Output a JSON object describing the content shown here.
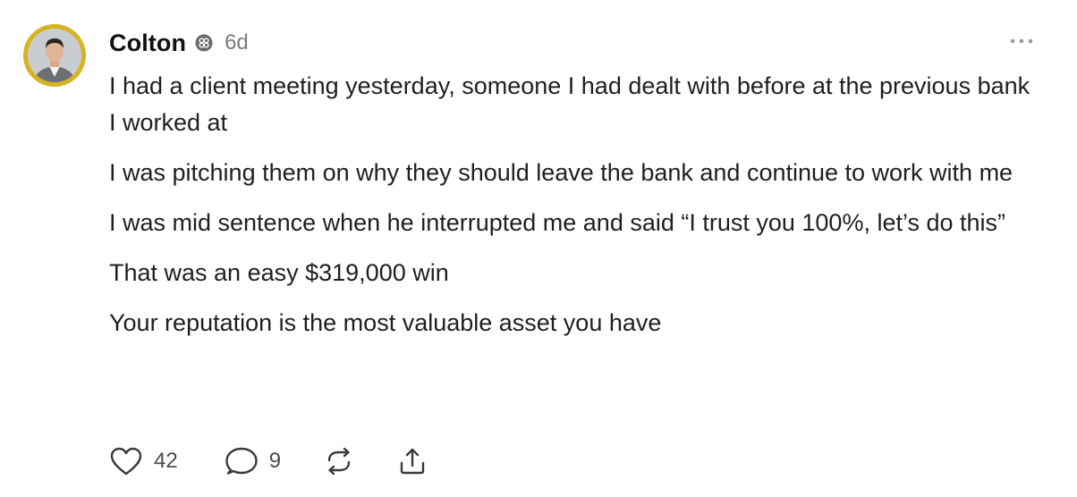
{
  "post": {
    "author": "Colton",
    "time": "6d",
    "paragraphs": [
      "I had a client meeting yesterday, someone I had dealt with before at the previous bank I worked at",
      "I was pitching them on why they should leave the bank and continue to work with me",
      "I was mid sentence when he interrupted me and said “I trust you 100%, let’s do this”",
      "That was an easy $319,000 win",
      "Your reputation is the most valuable asset you have"
    ],
    "likes": "42",
    "replies": "9"
  },
  "icons": {
    "badge": "flower-badge-icon",
    "more": "more-options-icon",
    "like": "heart-icon",
    "reply": "speech-bubble-icon",
    "repost": "repost-icon",
    "share": "share-icon"
  },
  "colors": {
    "avatar_ring": "#d9b21f",
    "text": "#1f1f1f",
    "muted": "#7a7a7a"
  }
}
